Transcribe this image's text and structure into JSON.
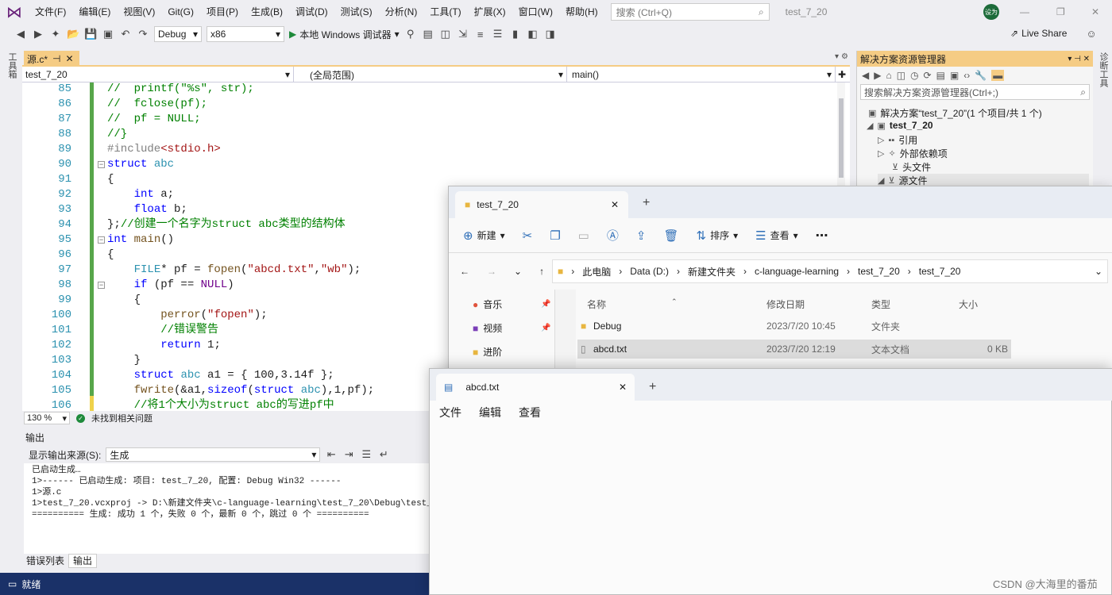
{
  "menubar": {
    "items": [
      "文件(F)",
      "编辑(E)",
      "视图(V)",
      "Git(G)",
      "项目(P)",
      "生成(B)",
      "调试(D)",
      "测试(S)",
      "分析(N)",
      "工具(T)",
      "扩展(X)",
      "窗口(W)",
      "帮助(H)"
    ],
    "search_placeholder": "搜索 (Ctrl+Q)",
    "project_title": "test_7_20",
    "avatar_text": "设为"
  },
  "toolbar": {
    "config": "Debug",
    "platform": "x86",
    "run_label": "本地 Windows 调试器",
    "live_share": "Live Share"
  },
  "side_tabs": {
    "left": "工具箱",
    "right": "诊断工具"
  },
  "editor": {
    "tab_label": "源.c*",
    "nav_project": "test_7_20",
    "nav_scope": "(全局范围)",
    "nav_member": "main()",
    "line_numbers": [
      "85",
      "86",
      "87",
      "88",
      "89",
      "90",
      "91",
      "92",
      "93",
      "94",
      "95",
      "96",
      "97",
      "98",
      "99",
      "100",
      "101",
      "102",
      "103",
      "104",
      "105",
      "106"
    ],
    "zoom": "130 %",
    "issues": "未找到相关问题"
  },
  "output": {
    "title": "输出",
    "source_label": "显示输出来源(S):",
    "source_value": "生成",
    "lines": [
      "已启动生成…",
      "1>------ 已启动生成: 项目: test_7_20, 配置: Debug Win32 ------",
      "1>源.c",
      "1>test_7_20.vcxproj -> D:\\新建文件夹\\c-language-learning\\test_7_20\\Debug\\test_7_20.exe",
      "========== 生成: 成功 1 个，失败 0 个，最新 0 个，跳过 0 个 =========="
    ],
    "tabs": [
      "错误列表",
      "输出"
    ]
  },
  "status": {
    "text": "就绪"
  },
  "solution_explorer": {
    "title": "解决方案资源管理器",
    "search_placeholder": "搜索解决方案资源管理器(Ctrl+;)",
    "solution": "解决方案“test_7_20”(1 个项目/共 1 个)",
    "project": "test_7_20",
    "nodes": [
      "引用",
      "外部依赖项",
      "头文件",
      "源文件"
    ]
  },
  "file_explorer": {
    "tab_title": "test_7_20",
    "commands": {
      "new": "新建",
      "sort": "排序",
      "view": "查看"
    },
    "breadcrumbs": [
      "此电脑",
      "Data (D:)",
      "新建文件夹",
      "c-language-learning",
      "test_7_20",
      "test_7_20"
    ],
    "nav": [
      "音乐",
      "视频",
      "进阶"
    ],
    "columns": {
      "name": "名称",
      "modified": "修改日期",
      "type": "类型",
      "size": "大小"
    },
    "files": [
      {
        "name": "Debug",
        "modified": "2023/7/20 10:45",
        "type": "文件夹",
        "size": ""
      },
      {
        "name": "abcd.txt",
        "modified": "2023/7/20 12:19",
        "type": "文本文档",
        "size": "0 KB"
      }
    ]
  },
  "notepad": {
    "tab_title": "abcd.txt",
    "menu": [
      "文件",
      "编辑",
      "查看"
    ]
  },
  "watermark": "CSDN @大海里的番茄"
}
